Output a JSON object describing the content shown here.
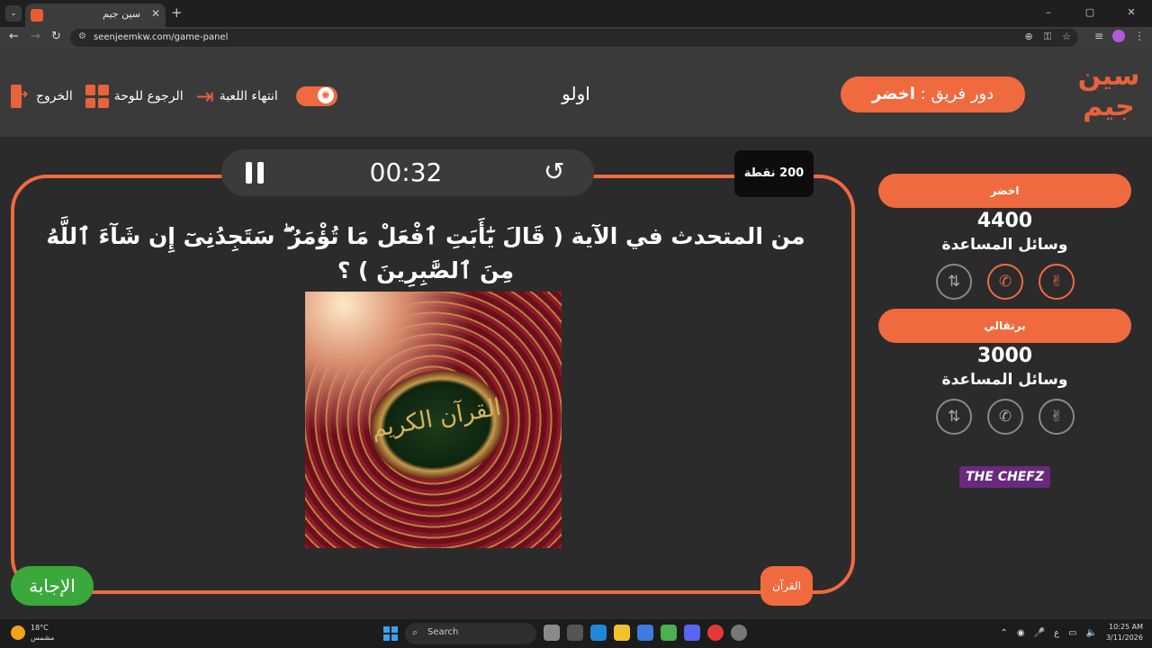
{
  "browser": {
    "tab_title": "سين جيم",
    "url": "seenjeemkw.com/game-panel",
    "window_controls": [
      "–",
      "▢",
      "✕"
    ]
  },
  "header": {
    "logo_text": "سين جيم",
    "turn_prefix": "دور فريق :",
    "turn_team": "اخضر",
    "current_team": "اولو",
    "actions": {
      "exit": "الخروج",
      "back_to_board": "الرجوع للوحة",
      "end_game": "انتهاء اللعبة"
    }
  },
  "timer": {
    "time": "00:32"
  },
  "points": "200 نقطة",
  "question": "من المتحدث في الآية ( قَالَ يَٰٓأَبَتِ ٱفْعَلْ مَا تُؤْمَرُ ۖ سَتَجِدُنِىٓ إِن شَآءَ ٱللَّهُ مِنَ ٱلصَّٰبِرِينَ ) ؟",
  "image": {
    "icon": "quran-cover-image",
    "medallion_text": "القرآن الكريم"
  },
  "answer_button": "الإجابة",
  "category": "القرآن",
  "teams": [
    {
      "name": "اخضر",
      "score": "4400",
      "help_label": "وسائل المساعدة",
      "helps_active": [
        false,
        true,
        true
      ]
    },
    {
      "name": "برتقالي",
      "score": "3000",
      "help_label": "وسائل المساعدة",
      "helps_active": [
        false,
        false,
        false
      ]
    }
  ],
  "sponsor": "THE CHEFZ",
  "taskbar": {
    "temperature": "18°C",
    "weather": "مشمس",
    "search_placeholder": "Search",
    "time": "10:25 AM",
    "date": "3/11/2026",
    "lang": "ع"
  },
  "colors": {
    "accent": "#f06a3f",
    "answer_green": "#3aa83a",
    "background": "#2b2b2b"
  }
}
